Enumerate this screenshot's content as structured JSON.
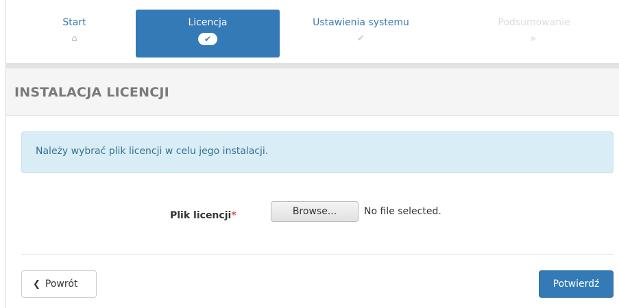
{
  "wizard": {
    "steps": [
      {
        "label": "Start",
        "icon": "home-icon",
        "glyph": "⌂",
        "state": "done"
      },
      {
        "label": "Licencja",
        "icon": "check-icon",
        "glyph": "✔",
        "state": "active"
      },
      {
        "label": "Ustawienia systemu",
        "icon": "check-icon",
        "glyph": "✔",
        "state": "pending"
      },
      {
        "label": "Podsumowanie",
        "icon": "play-icon",
        "glyph": "▶",
        "state": "disabled"
      }
    ]
  },
  "section": {
    "title": "INSTALACJA LICENCJI"
  },
  "alert": {
    "text": "Należy wybrać plik licencji w celu jego instalacji."
  },
  "form": {
    "file_label": "Plik licencji",
    "required_marker": "*",
    "browse_label": "Browse...",
    "file_status": "No file selected."
  },
  "footer": {
    "back_chevron": "❮",
    "back_label": "Powrót",
    "confirm_label": "Potwierdź"
  },
  "colors": {
    "primary": "#337ab7",
    "info_bg": "#d9edf7",
    "info_text": "#31708f",
    "required": "#d9534f"
  }
}
